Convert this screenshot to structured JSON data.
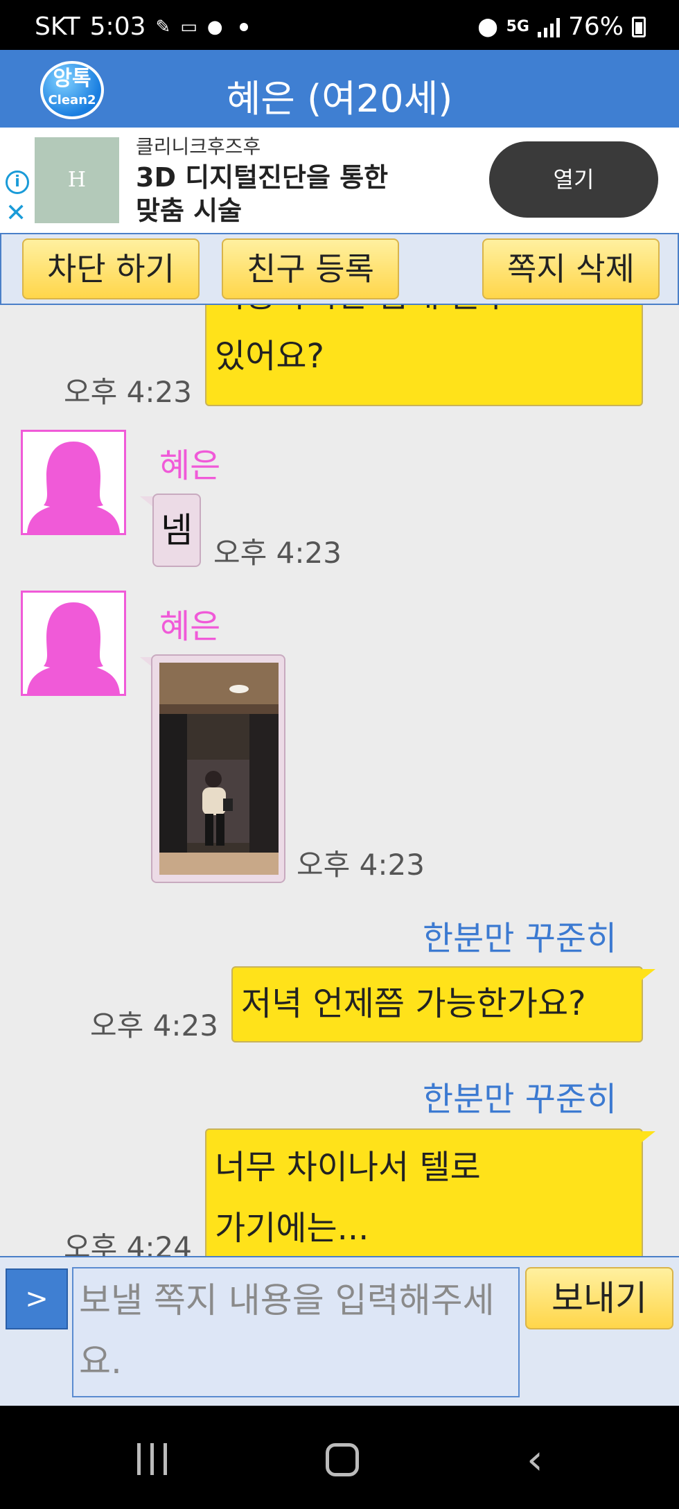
{
  "status_bar": {
    "carrier": "SKT",
    "time": "5:03",
    "network": "5G",
    "battery": "76%",
    "icons": [
      "notification-icon",
      "voicemail-icon",
      "talk-icon",
      "location-icon",
      "signal-icon",
      "battery-icon"
    ]
  },
  "app_bar": {
    "logo_line1": "앙톡",
    "logo_line2": "Clean2",
    "title": "혜은 (여20세)"
  },
  "ad": {
    "thumb_letter": "H",
    "sponsor": "클리니크후즈후",
    "headline": "3D 디지털진단을 통한 맞춤 시술",
    "open_label": "열기"
  },
  "actions": {
    "block_label": "차단 하기",
    "friend_label": "친구 등록",
    "delete_label": "쪽지 삭제"
  },
  "messages": [
    {
      "from": "me",
      "text_line1": "죄송하시만  몸매 볼수",
      "text_line2": "있어요?",
      "time": "오후 4:23"
    },
    {
      "from": "other",
      "name": "혜은",
      "text": "넴",
      "time": "오후 4:23"
    },
    {
      "from": "other",
      "name": "혜은",
      "type": "photo",
      "time": "오후 4:23"
    },
    {
      "from": "me",
      "name": "한분만 꾸준히",
      "text": "저녁 언제쯤 가능한가요?",
      "time": "오후 4:23"
    },
    {
      "from": "me",
      "name": "한분만 꾸준히",
      "text_line1": "너무 차이나서 텔로",
      "text_line2": "가기에는...",
      "time": "오후 4:24"
    }
  ],
  "composer": {
    "expand_label": ">",
    "placeholder": "보낼 쪽지 내용을 입력해주세요.",
    "send_label": "보내기"
  },
  "colors": {
    "app_bar": "#3f7fd2",
    "my_bubble": "#ffe21a",
    "other_bubble": "#ecdbe6",
    "other_name": "#f05ad8",
    "my_name": "#3c7ad1"
  }
}
